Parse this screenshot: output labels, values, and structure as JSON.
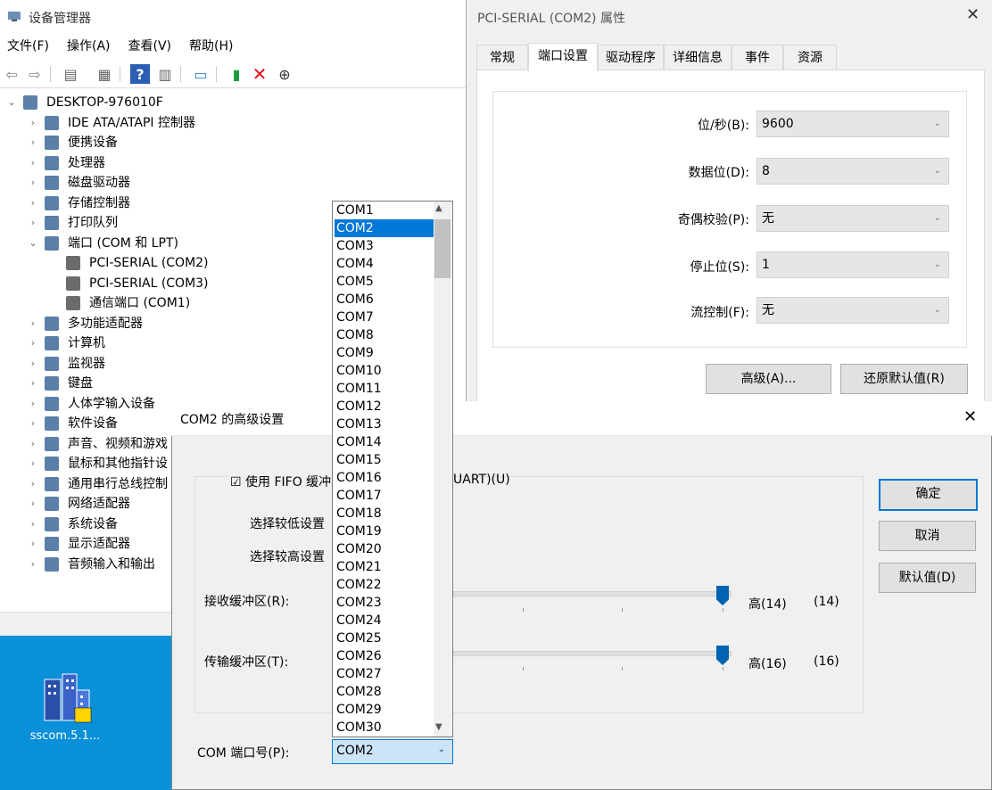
{
  "desktop": {
    "icon_label": "sscom.5.1..."
  },
  "devmgr": {
    "title": "设备管理器",
    "menu": [
      "文件(F)",
      "操作(A)",
      "查看(V)",
      "帮助(H)"
    ],
    "tree": [
      {
        "label": "DESKTOP-976010F",
        "level": 0,
        "expanded": true,
        "icon": "computer-icon"
      },
      {
        "label": "IDE ATA/ATAPI 控制器",
        "level": 1,
        "icon": "ide-icon"
      },
      {
        "label": "便携设备",
        "level": 1,
        "icon": "portable-icon"
      },
      {
        "label": "处理器",
        "level": 1,
        "icon": "cpu-icon"
      },
      {
        "label": "磁盘驱动器",
        "level": 1,
        "icon": "disk-icon"
      },
      {
        "label": "存储控制器",
        "level": 1,
        "icon": "storage-icon"
      },
      {
        "label": "打印队列",
        "level": 1,
        "icon": "printer-icon"
      },
      {
        "label": "端口 (COM 和 LPT)",
        "level": 1,
        "expanded": true,
        "icon": "port-icon"
      },
      {
        "label": "PCI-SERIAL (COM2)",
        "level": 2,
        "icon": "port-icon"
      },
      {
        "label": "PCI-SERIAL (COM3)",
        "level": 2,
        "icon": "port-icon"
      },
      {
        "label": "通信端口 (COM1)",
        "level": 2,
        "icon": "port-icon"
      },
      {
        "label": "多功能适配器",
        "level": 1,
        "icon": "multifunction-icon"
      },
      {
        "label": "计算机",
        "level": 1,
        "icon": "computer-icon"
      },
      {
        "label": "监视器",
        "level": 1,
        "icon": "monitor-icon"
      },
      {
        "label": "键盘",
        "level": 1,
        "icon": "keyboard-icon"
      },
      {
        "label": "人体学输入设备",
        "level": 1,
        "icon": "hid-icon"
      },
      {
        "label": "软件设备",
        "level": 1,
        "icon": "software-icon"
      },
      {
        "label": "声音、视频和游戏",
        "level": 1,
        "icon": "sound-icon"
      },
      {
        "label": "鼠标和其他指针设",
        "level": 1,
        "icon": "mouse-icon"
      },
      {
        "label": "通用串行总线控制",
        "level": 1,
        "icon": "usb-icon"
      },
      {
        "label": "网络适配器",
        "level": 1,
        "icon": "network-icon"
      },
      {
        "label": "系统设备",
        "level": 1,
        "icon": "system-icon"
      },
      {
        "label": "显示适配器",
        "level": 1,
        "icon": "display-icon"
      },
      {
        "label": "音频输入和输出",
        "level": 1,
        "icon": "audio-icon"
      }
    ]
  },
  "props": {
    "title": "PCI-SERIAL (COM2) 属性",
    "tabs": [
      "常规",
      "端口设置",
      "驱动程序",
      "详细信息",
      "事件",
      "资源"
    ],
    "active_tab": "端口设置",
    "fields": [
      {
        "label": "位/秒(B):",
        "value": "9600"
      },
      {
        "label": "数据位(D):",
        "value": "8"
      },
      {
        "label": "奇偶校验(P):",
        "value": "无"
      },
      {
        "label": "停止位(S):",
        "value": "1"
      },
      {
        "label": "流控制(F):",
        "value": "无"
      }
    ],
    "advanced_button": "高级(A)...",
    "restore_button": "还原默认值(R)"
  },
  "adv": {
    "title": "COM2 的高级设置",
    "fifo_label": "使用 FIFO 缓冲",
    "fifo_tail": "UART)(U)",
    "low_label": "选择较低设置",
    "high_label": "选择较高设置",
    "rx_label": "接收缓冲区(R):",
    "rx_value_label": "高(14)",
    "rx_value": "(14)",
    "rx_level": 1.0,
    "tx_label": "传输缓冲区(T):",
    "tx_value_label": "高(16)",
    "tx_value": "(16)",
    "tx_level": 1.0,
    "ok": "确定",
    "cancel": "取消",
    "defaults": "默认值(D)",
    "com_label": "COM 端口号(P):",
    "com_value": "COM2"
  },
  "dropdown": {
    "items": [
      "COM1",
      "COM2",
      "COM3",
      "COM4",
      "COM5",
      "COM6",
      "COM7",
      "COM8",
      "COM9",
      "COM10",
      "COM11",
      "COM12",
      "COM13",
      "COM14",
      "COM15",
      "COM16",
      "COM17",
      "COM18",
      "COM19",
      "COM20",
      "COM21",
      "COM22",
      "COM23",
      "COM24",
      "COM25",
      "COM26",
      "COM27",
      "COM28",
      "COM29",
      "COM30"
    ],
    "selected": "COM2"
  },
  "colors": {
    "accent": "#0078d7",
    "desktop": "#0a8fd9",
    "close_red": "#e81123"
  }
}
